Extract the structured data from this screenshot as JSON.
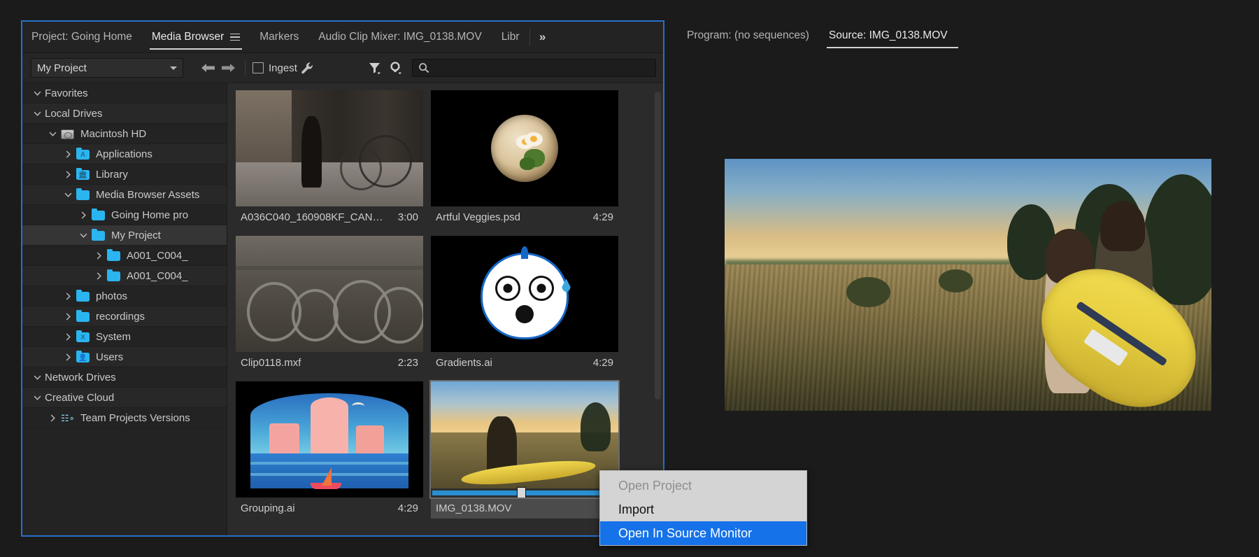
{
  "media_browser": {
    "tabs": [
      {
        "label": "Project: Going Home",
        "active": false,
        "menu": false
      },
      {
        "label": "Media Browser",
        "active": true,
        "menu": true
      },
      {
        "label": "Markers",
        "active": false,
        "menu": false
      },
      {
        "label": "Audio Clip Mixer: IMG_0138.MOV",
        "active": false,
        "menu": false
      }
    ],
    "clipped_tab": "Libr",
    "overflow_label": "»",
    "toolbar": {
      "project_selector": "My Project",
      "back_label": "back-arrow",
      "forward_label": "forward-arrow",
      "ingest_label": "Ingest",
      "wrench_label": "settings-wrench",
      "filter_label": "filter",
      "view_label": "view-options",
      "search_value": "",
      "search_placeholder": ""
    },
    "tree": [
      {
        "label": "Favorites",
        "depth": 0,
        "state": "expanded",
        "icon": "none",
        "selected": false
      },
      {
        "label": "Local Drives",
        "depth": 0,
        "state": "expanded",
        "icon": "none",
        "selected": false
      },
      {
        "label": "Macintosh HD",
        "depth": 1,
        "state": "expanded",
        "icon": "hdd",
        "selected": false
      },
      {
        "label": "Applications",
        "depth": 2,
        "state": "collapsed",
        "icon": "folder-apps",
        "selected": false
      },
      {
        "label": "Library",
        "depth": 2,
        "state": "collapsed",
        "icon": "folder-library",
        "selected": false
      },
      {
        "label": "Media Browser Assets",
        "depth": 2,
        "state": "expanded",
        "icon": "folder",
        "selected": false
      },
      {
        "label": "Going Home pro",
        "depth": 3,
        "state": "collapsed",
        "icon": "folder",
        "selected": false
      },
      {
        "label": "My Project",
        "depth": 3,
        "state": "expanded",
        "icon": "folder",
        "selected": true
      },
      {
        "label": "A001_C004_",
        "depth": 4,
        "state": "collapsed",
        "icon": "folder",
        "selected": false
      },
      {
        "label": "A001_C004_",
        "depth": 4,
        "state": "collapsed",
        "icon": "folder",
        "selected": false
      },
      {
        "label": "photos",
        "depth": 2,
        "state": "collapsed",
        "icon": "folder",
        "selected": false
      },
      {
        "label": "recordings",
        "depth": 2,
        "state": "collapsed",
        "icon": "folder",
        "selected": false
      },
      {
        "label": "System",
        "depth": 2,
        "state": "collapsed",
        "icon": "folder-system",
        "selected": false
      },
      {
        "label": "Users",
        "depth": 2,
        "state": "collapsed",
        "icon": "folder-users",
        "selected": false
      },
      {
        "label": "Network Drives",
        "depth": 0,
        "state": "expanded",
        "icon": "none",
        "selected": false
      },
      {
        "label": "Creative Cloud",
        "depth": 0,
        "state": "expanded",
        "icon": "none",
        "selected": false
      },
      {
        "label": "Team Projects Versions",
        "depth": 1,
        "state": "collapsed",
        "icon": "teamprojects",
        "selected": false
      }
    ],
    "items": [
      {
        "name": "A036C040_160908KF_CAN…",
        "duration": "3:00",
        "art": "alley",
        "selected": false
      },
      {
        "name": "Artful Veggies.psd",
        "duration": "4:29",
        "art": "veggies",
        "selected": false
      },
      {
        "name": "Clip0118.mxf",
        "duration": "2:23",
        "art": "bikes",
        "selected": false
      },
      {
        "name": "Gradients.ai",
        "duration": "4:29",
        "art": "bird",
        "selected": false
      },
      {
        "name": "Grouping.ai",
        "duration": "4:29",
        "art": "city",
        "selected": false
      },
      {
        "name": "IMG_0138.MOV",
        "duration": "",
        "art": "surf",
        "selected": true
      }
    ]
  },
  "source_panel": {
    "tabs": [
      {
        "label": "Program: (no sequences)",
        "active": false,
        "menu": false
      },
      {
        "label": "Source: IMG_0138.MOV",
        "active": true,
        "menu": true
      }
    ]
  },
  "context_menu": {
    "items": [
      {
        "label": "Open Project",
        "state": "disabled"
      },
      {
        "label": "Import",
        "state": "normal"
      },
      {
        "label": "Open In Source Monitor",
        "state": "highlight"
      }
    ]
  },
  "colors": {
    "panel_focus_border": "#2a6fc9",
    "menu_highlight": "#1672e8",
    "folder_blue": "#2ab5f0",
    "app_background": "#1b1b1b"
  }
}
